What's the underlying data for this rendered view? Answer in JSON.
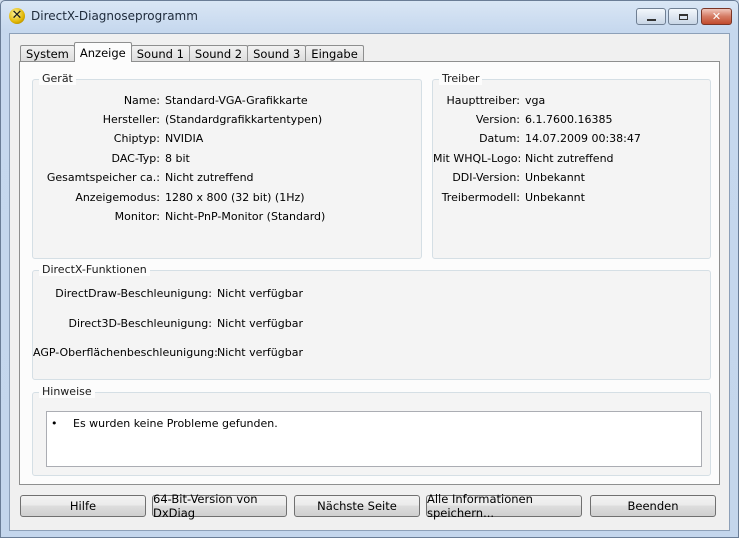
{
  "window": {
    "title": "DirectX-Diagnoseprogramm"
  },
  "tabs": [
    "System",
    "Anzeige",
    "Sound 1",
    "Sound 2",
    "Sound 3",
    "Eingabe"
  ],
  "device": {
    "title": "Gerät",
    "rows": [
      {
        "label": "Name:",
        "value": "Standard-VGA-Grafikkarte"
      },
      {
        "label": "Hersteller:",
        "value": "(Standardgrafikkartentypen)"
      },
      {
        "label": "Chiptyp:",
        "value": "NVIDIA"
      },
      {
        "label": "DAC-Typ:",
        "value": "8 bit"
      },
      {
        "label": "Gesamtspeicher ca.:",
        "value": "Nicht zutreffend"
      },
      {
        "label": "Anzeigemodus:",
        "value": "1280 x 800 (32 bit) (1Hz)"
      },
      {
        "label": "Monitor:",
        "value": "Nicht-PnP-Monitor (Standard)"
      }
    ]
  },
  "driver": {
    "title": "Treiber",
    "rows": [
      {
        "label": "Haupttreiber:",
        "value": "vga"
      },
      {
        "label": "Version:",
        "value": "6.1.7600.16385"
      },
      {
        "label": "Datum:",
        "value": "14.07.2009 00:38:47"
      },
      {
        "label": "Mit WHQL-Logo:",
        "value": "Nicht zutreffend"
      },
      {
        "label": "DDI-Version:",
        "value": "Unbekannt"
      },
      {
        "label": "Treibermodell:",
        "value": "Unbekannt"
      }
    ]
  },
  "features": {
    "title": "DirectX-Funktionen",
    "rows": [
      {
        "label": "DirectDraw-Beschleunigung:",
        "value": "Nicht verfügbar"
      },
      {
        "label": "Direct3D-Beschleunigung:",
        "value": "Nicht verfügbar"
      },
      {
        "label": "AGP-Oberflächenbeschleunigung:",
        "value": "Nicht verfügbar"
      }
    ]
  },
  "notes": {
    "title": "Hinweise",
    "bullet": "•",
    "text": "Es wurden keine Probleme gefunden."
  },
  "buttons": {
    "help": "Hilfe",
    "x64": "64-Bit-Version von DxDiag",
    "next": "Nächste Seite",
    "save": "Alle Informationen speichern...",
    "exit": "Beenden"
  },
  "icons": {
    "app": "directx-icon",
    "minimize": "minimize-icon",
    "maximize": "maximize-icon",
    "close": "close-icon"
  }
}
